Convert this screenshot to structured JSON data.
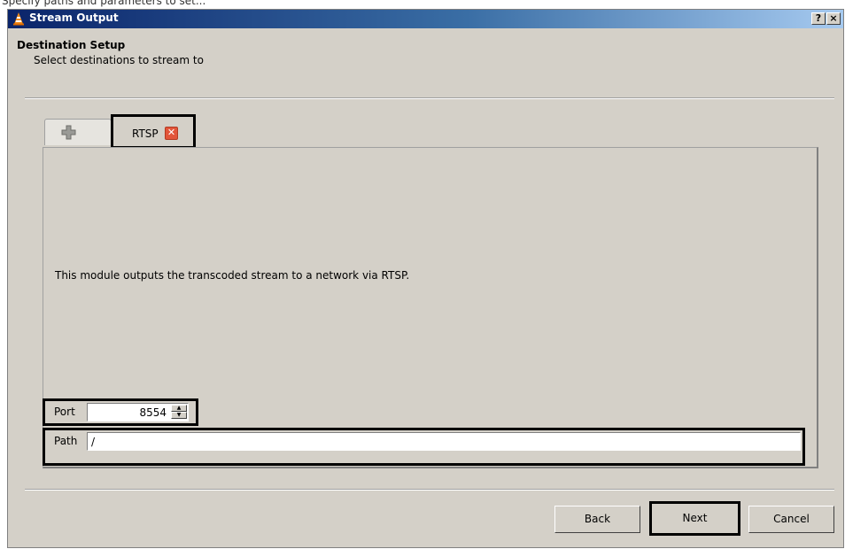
{
  "window": {
    "title": "Stream Output",
    "help_label": "?",
    "close_label": "×"
  },
  "header": {
    "title": "Destination Setup",
    "subtitle": "Select destinations to stream to"
  },
  "tabs": [
    {
      "icon": "plus-icon"
    },
    {
      "label": "RTSP",
      "close_icon": "close-icon"
    }
  ],
  "panel": {
    "description": "This module outputs the transcoded stream to a network via RTSP."
  },
  "fields": {
    "port_label": "Port",
    "port_value": "8554",
    "path_label": "Path",
    "path_value": "/"
  },
  "buttons": {
    "back": "Back",
    "next": "Next",
    "cancel": "Cancel"
  },
  "colors": {
    "dialog_bg": "#d4d0c8",
    "titlebar_start": "#0a246a",
    "titlebar_end": "#a6caf0",
    "tab_close": "#e2553a",
    "highlight_border": "#000000"
  }
}
